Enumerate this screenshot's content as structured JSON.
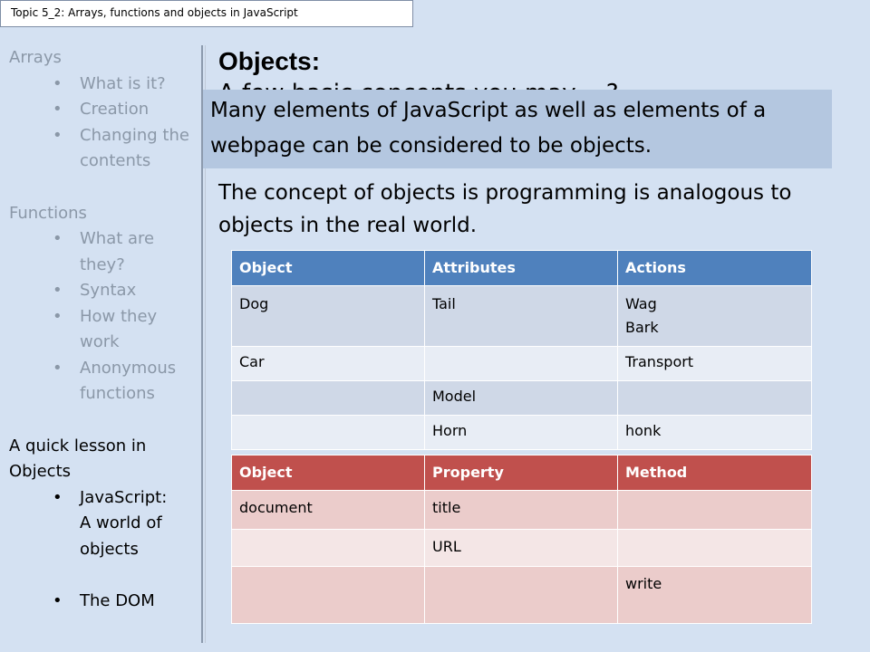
{
  "topic": "Topic 5_2: Arrays, functions and objects in JavaScript",
  "sidebar": {
    "arrays": {
      "title": "Arrays",
      "items": [
        "What is it?",
        "Creation",
        "Changing the",
        "contents"
      ]
    },
    "functions": {
      "title": "Functions",
      "items": [
        "What are",
        "they?",
        "Syntax",
        "How they",
        "work",
        "Anonymous",
        "functions"
      ]
    },
    "objects": {
      "title_line1": "A quick lesson in",
      "title_line2": "Objects",
      "items": [
        "JavaScript:",
        "A world of",
        "objects",
        "The DOM"
      ]
    },
    "bullet": "•"
  },
  "slide": {
    "title": "Objects:",
    "hidden_line": "A few basic concepts you may ...?",
    "callout": "Many elements of JavaScript as well as elements of a webpage can be considered to be objects.",
    "concept": "The concept of objects is programming is analogous to objects in the real world."
  },
  "table1": {
    "headers": [
      "Object",
      "Attributes",
      "Actions"
    ],
    "rows": [
      [
        "Dog",
        "Tail",
        "Wag",
        "Bark"
      ],
      [
        "Car",
        "",
        "Transport"
      ],
      [
        "",
        "Model",
        ""
      ],
      [
        "",
        "Horn",
        "honk"
      ]
    ]
  },
  "table2": {
    "headers": [
      "Object",
      "Property",
      "Method"
    ],
    "rows": [
      [
        "document",
        "title",
        ""
      ],
      [
        "",
        "URL",
        ""
      ],
      [
        "",
        "",
        "write"
      ]
    ]
  }
}
